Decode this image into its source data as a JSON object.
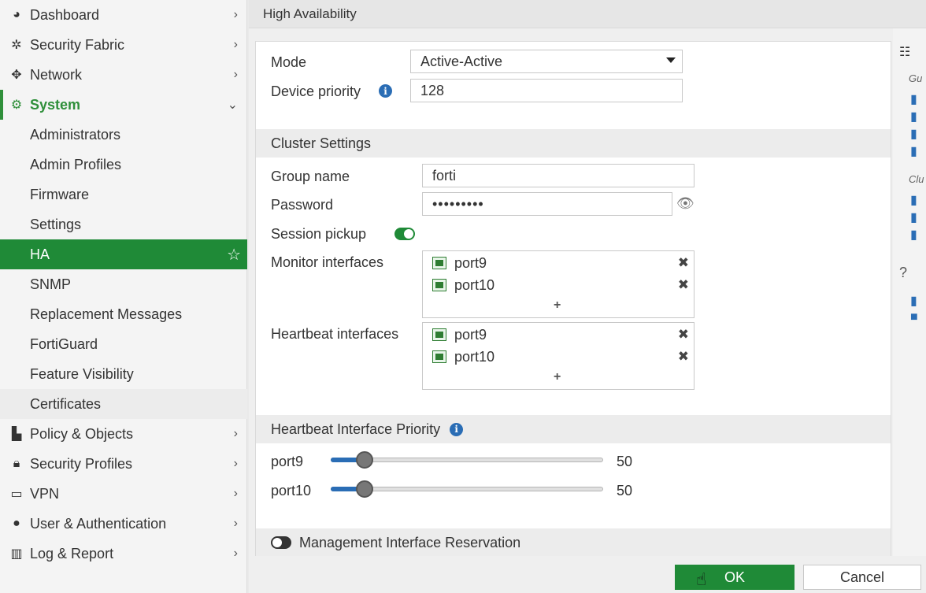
{
  "sidebar": {
    "items": [
      {
        "label": "Dashboard",
        "icon": "dashboard-icon"
      },
      {
        "label": "Security Fabric",
        "icon": "fabric-icon"
      },
      {
        "label": "Network",
        "icon": "network-icon"
      },
      {
        "label": "System",
        "icon": "gear-icon"
      }
    ],
    "system_sub": [
      {
        "label": "Administrators"
      },
      {
        "label": "Admin Profiles"
      },
      {
        "label": "Firmware"
      },
      {
        "label": "Settings"
      },
      {
        "label": "HA"
      },
      {
        "label": "SNMP"
      },
      {
        "label": "Replacement Messages"
      },
      {
        "label": "FortiGuard"
      },
      {
        "label": "Feature Visibility"
      },
      {
        "label": "Certificates"
      }
    ],
    "bottom_items": [
      {
        "label": "Policy & Objects",
        "icon": "policy-icon"
      },
      {
        "label": "Security Profiles",
        "icon": "lock-icon"
      },
      {
        "label": "VPN",
        "icon": "laptop-icon"
      },
      {
        "label": "User & Authentication",
        "icon": "user-icon"
      },
      {
        "label": "Log & Report",
        "icon": "chart-icon"
      }
    ]
  },
  "header": {
    "title": "High Availability"
  },
  "form": {
    "mode_label": "Mode",
    "mode_value": "Active-Active",
    "priority_label": "Device priority",
    "priority_value": "128",
    "cluster_title": "Cluster Settings",
    "group_label": "Group name",
    "group_value": "forti",
    "password_label": "Password",
    "password_value": "•••••••••",
    "session_label": "Session pickup",
    "session_pickup_enabled": true,
    "monitor_label": "Monitor interfaces",
    "monitor_interfaces": [
      "port9",
      "port10"
    ],
    "heartbeat_label": "Heartbeat interfaces",
    "heartbeat_interfaces": [
      "port9",
      "port10"
    ],
    "hb_priority_title": "Heartbeat Interface Priority",
    "priorities": [
      {
        "port": "port9",
        "value": "50"
      },
      {
        "port": "port10",
        "value": "50"
      }
    ],
    "mgmt_reservation_label": "Management Interface Reservation",
    "mgmt_reservation_enabled": false,
    "add_symbol": "+",
    "remove_symbol": "✖"
  },
  "right_panel": {
    "guide_abbrev": "Gu",
    "cluster_abbrev": "Clu"
  },
  "footer": {
    "ok_label": "OK",
    "cancel_label": "Cancel"
  },
  "colors": {
    "accent": "#1f8a37",
    "info": "#2a6db5"
  }
}
